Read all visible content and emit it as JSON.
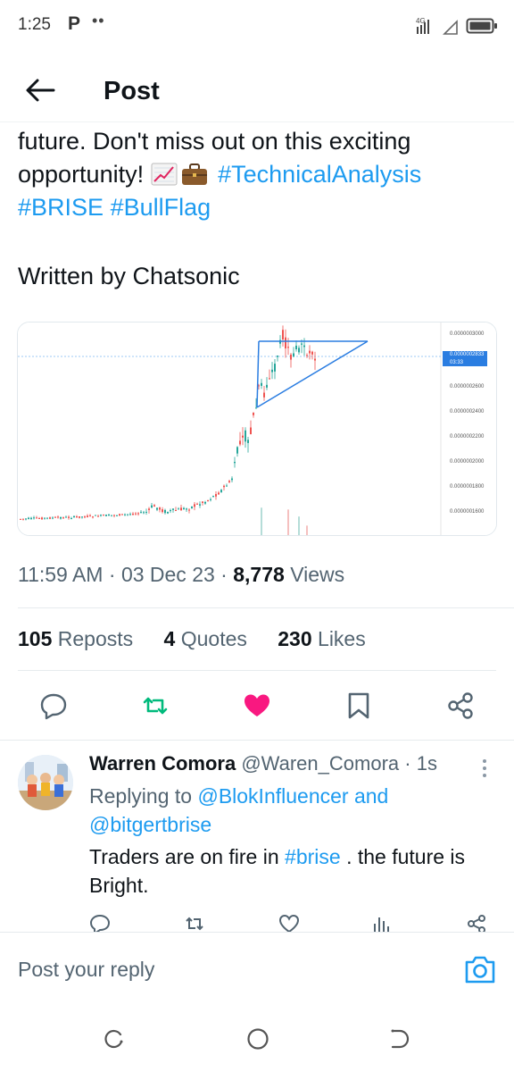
{
  "status_bar": {
    "time": "1:25",
    "app_icon": "P",
    "dots": "••",
    "network": "4G",
    "icons": [
      "signal-icon",
      "wifi-icon",
      "battery-icon"
    ]
  },
  "header": {
    "title": "Post",
    "back_icon": "arrow-left-icon"
  },
  "post": {
    "text_line1": "future. Don't miss out on this exciting",
    "text_line2_prefix": "opportunity!",
    "emojis": [
      "chart-increasing-emoji",
      "briefcase-emoji"
    ],
    "hashtags": [
      "#TechnicalAnalysis",
      "#BRISE",
      "#BullFlag"
    ],
    "written_by": "Written by Chatsonic",
    "chart_prices": [
      "0.0000003000",
      "0.0000002833",
      "03:33",
      "0.0000002600",
      "0.0000002400",
      "0.0000002200",
      "0.0000002000",
      "0.0000001800",
      "0.0000001600"
    ],
    "time": "11:59 AM",
    "date": "03 Dec 23",
    "views_count": "8,778",
    "views_label": "Views",
    "reposts_count": "105",
    "reposts_label": "Reposts",
    "quotes_count": "4",
    "quotes_label": "Quotes",
    "likes_count": "230",
    "likes_label": "Likes"
  },
  "colors": {
    "accent": "#1d9bf0",
    "repost_active": "#00ba7c",
    "like_active": "#f91880",
    "text_primary": "#0f1419",
    "text_secondary": "#536471"
  },
  "reply": {
    "name": "Warren Comora",
    "handle": "@Waren_Comora",
    "time": "· 1s",
    "replying_prefix": "Replying to",
    "replying_to_1": "@BlokInfluencer",
    "replying_and": "and",
    "replying_to_2": "@bitgertbrise",
    "text_before": "Traders are on fire in",
    "text_tag": "#brise",
    "text_after": ". the future is Bright."
  },
  "compose": {
    "placeholder": "Post your reply"
  }
}
